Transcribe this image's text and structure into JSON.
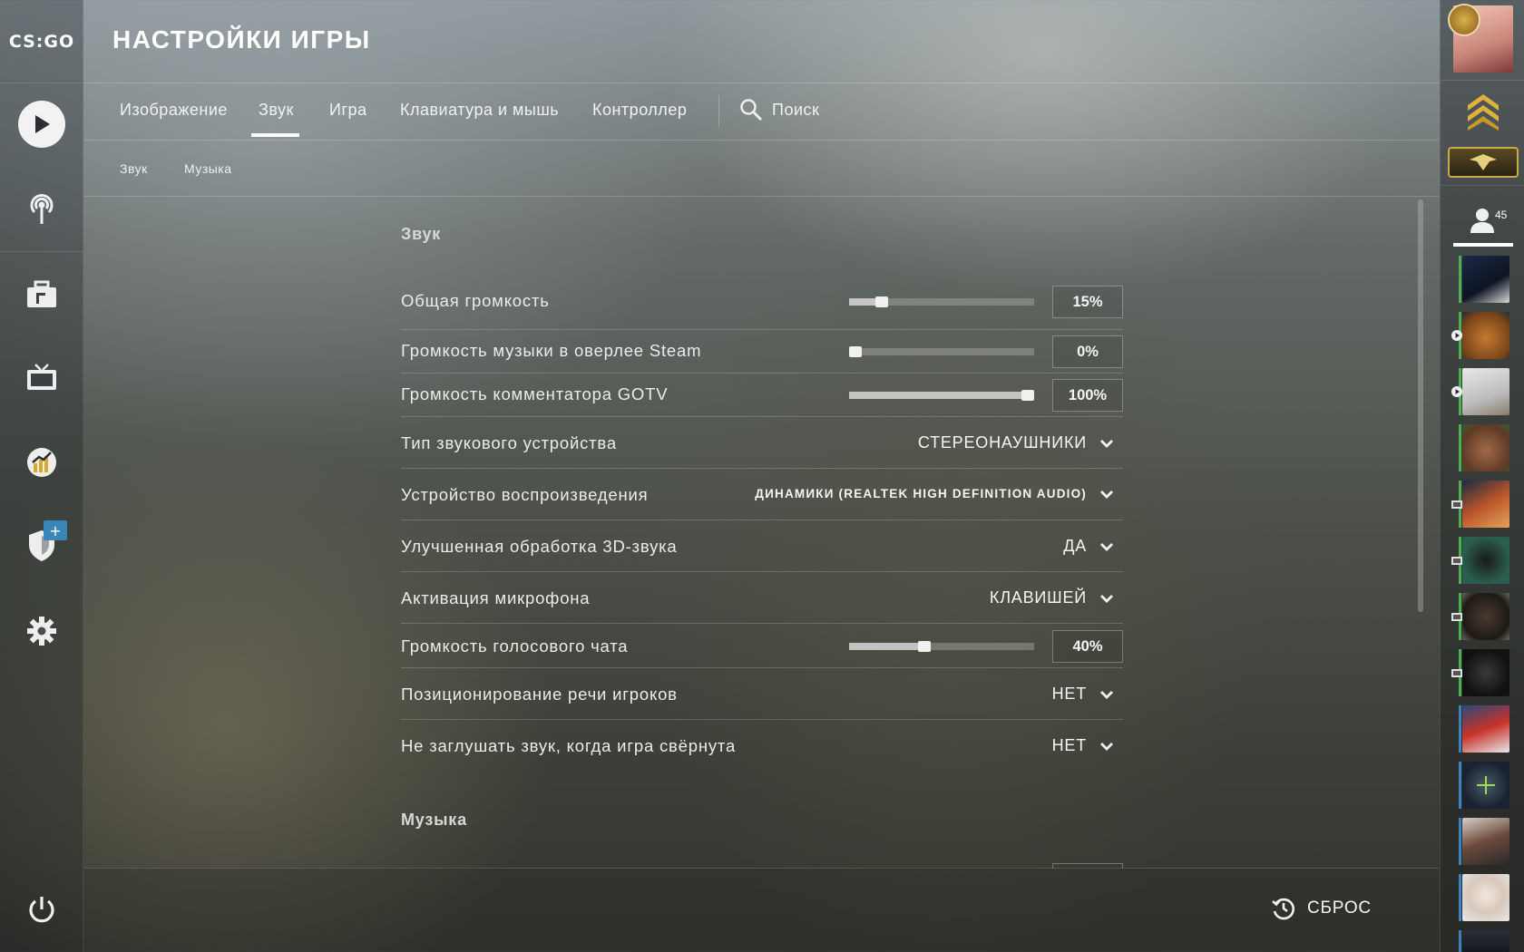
{
  "app": {
    "logo_text": "CS:GO"
  },
  "header": {
    "title": "НАСТРОЙКИ ИГРЫ"
  },
  "tabs": [
    {
      "label": "Изображение"
    },
    {
      "label": "Звук"
    },
    {
      "label": "Игра"
    },
    {
      "label": "Клавиатура и мышь"
    },
    {
      "label": "Контроллер"
    }
  ],
  "active_tab": "Звук",
  "search": {
    "label": "Поиск"
  },
  "subtabs": [
    {
      "label": "Звук"
    },
    {
      "label": "Музыка"
    }
  ],
  "sound_section": {
    "title": "Звук",
    "master_volume": {
      "label": "Общая громкость",
      "value": "15%",
      "level": 0.15
    },
    "steam_overlay_music": {
      "label": "Громкость музыки в оверлее Steam",
      "value": "0%",
      "level": 0.0
    },
    "gotv_volume": {
      "label": "Громкость комментатора GOTV",
      "value": "100%",
      "level": 1.0
    },
    "audio_device_type": {
      "label": "Тип звукового устройства",
      "value": "СТЕРЕОНАУШНИКИ"
    },
    "playback_device": {
      "label": "Устройство воспроизведения",
      "value": "ДИНАМИКИ (REALTEK HIGH DEFINITION AUDIO)"
    },
    "enhanced_3d": {
      "label": "Улучшенная обработка 3D-звука",
      "value": "ДА"
    },
    "mic_activation": {
      "label": "Активация микрофона",
      "value": "КЛАВИШЕЙ"
    },
    "voice_chat_volume": {
      "label": "Громкость голосового чата",
      "value": "40%",
      "level": 0.4
    },
    "speech_positioning": {
      "label": "Позиционирование речи игроков",
      "value": "НЕТ"
    },
    "unmute_minimized": {
      "label": "Не заглушать звук, когда игра свёрнута",
      "value": "НЕТ"
    }
  },
  "music_section": {
    "title": "Музыка"
  },
  "footer": {
    "reset_label": "СБРОС"
  },
  "friends": {
    "count": "45"
  },
  "colors": {
    "accent_badge": "#3a86b8",
    "online_green": "#4caf50",
    "ingame_blue": "#3b82c4"
  }
}
